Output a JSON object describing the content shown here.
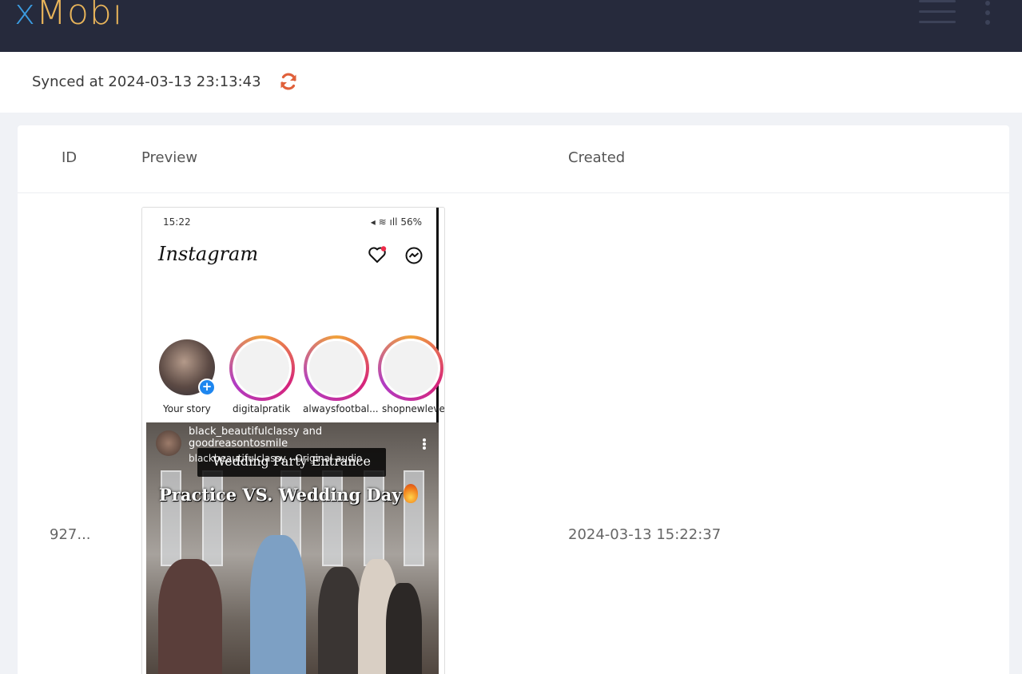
{
  "app": {
    "logo_x": "x",
    "logo_rest": "Mobi",
    "menu_icon": "hamburger-menu-icon",
    "more_icon": "kebab-menu-icon",
    "colors": {
      "navbar": "#262a3c",
      "logo_x": "#3b9be0",
      "logo_rest": "#e8b45a",
      "sync_icon": "#e0603a"
    }
  },
  "sync": {
    "label": "Synced at 2024-03-13 23:13:43",
    "icon": "refresh-icon"
  },
  "table": {
    "headers": {
      "id": "ID",
      "preview": "Preview",
      "created": "Created"
    },
    "rows": [
      {
        "id": "927...",
        "created": "2024-03-13 15:22:37",
        "preview": {
          "time": "15:22",
          "status": "56%",
          "app_name": "Instagram",
          "stories": [
            {
              "label": "Your story"
            },
            {
              "label": "digitalpratik"
            },
            {
              "label": "alwaysfootbal..."
            },
            {
              "label": "shopnewleve"
            }
          ],
          "post": {
            "users_line1": "black_beautifulclassy and",
            "users_line2": "goodreasontosmile",
            "audio": "blackbeautifulclassy · Original audio",
            "banner": "Wedding Party Entrance",
            "caption": "Practice VS. Wedding Day"
          }
        }
      }
    ]
  }
}
